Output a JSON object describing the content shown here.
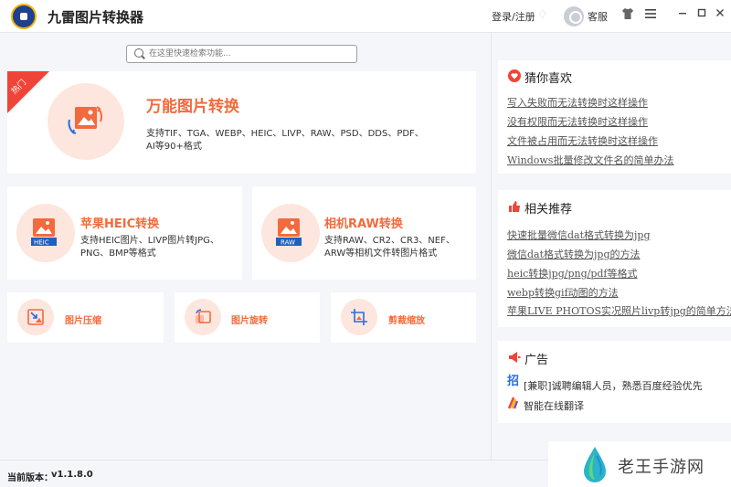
{
  "header": {
    "title": "九雷图片转换器",
    "login_label": "登录/注册",
    "service_label": "客服"
  },
  "search": {
    "placeholder": "在这里快速检索功能..."
  },
  "hot_card": {
    "badge": "热门",
    "title": "万能图片转换",
    "desc_line1": "支持TIF、TGA、WEBP、HEIC、LIVP、RAW、PSD、DDS、PDF、",
    "desc_line2": "AI等90+格式"
  },
  "features": [
    {
      "title": "苹果HEIC转换",
      "icon_label": "HEIC",
      "desc_line1": "支持HEIC图片、LIVP图片转JPG、",
      "desc_line2": "PNG、BMP等格式"
    },
    {
      "title": "相机RAW转换",
      "icon_label": "RAW",
      "desc_line1": "支持RAW、CR2、CR3、NEF、",
      "desc_line2": "ARW等相机文件转图片格式"
    }
  ],
  "tools": [
    {
      "label": "图片压缩"
    },
    {
      "label": "图片旋转"
    },
    {
      "label": "剪裁缩放"
    }
  ],
  "guess": {
    "title": "猜你喜欢",
    "links": [
      "写入失败而无法转换时这样操作",
      "没有权限而无法转换时这样操作",
      "文件被占用而无法转换时这样操作",
      "Windows批量修改文件名的简单办法"
    ]
  },
  "recommend": {
    "title": "相关推荐",
    "links": [
      "快速批量微信dat格式转换为jpg",
      "微信dat格式转换为jpg的方法",
      "heic转换jpg/png/pdf等格式",
      "webp转换gif动图的方法",
      "苹果LIVE PHOTOS实况照片livp转jpg的简单方法"
    ]
  },
  "ads": {
    "title": "广告",
    "icon1_glyph": "招",
    "items": [
      "[兼职]诚聘编辑人员，熟悉百度经验优先",
      "智能在线翻译"
    ]
  },
  "status": {
    "version_label": "当前版本：",
    "version": "v1.1.8.0"
  },
  "watermark": {
    "text": "老王手游网"
  },
  "colors": {
    "accent": "#f26a3d",
    "hot_ribbon": "#f04438",
    "icon_bg": "#fde6dd"
  }
}
